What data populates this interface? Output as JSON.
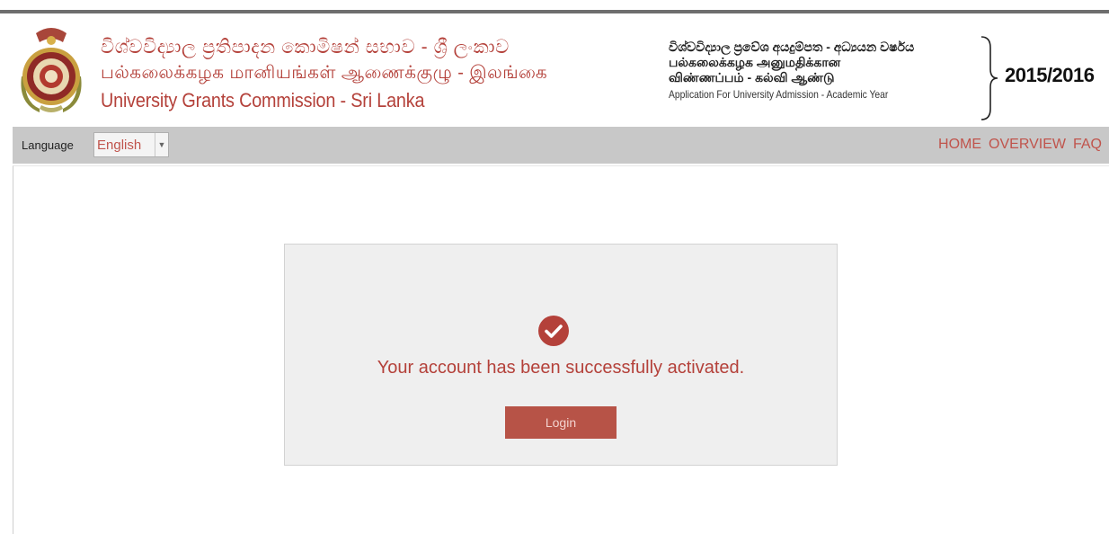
{
  "header": {
    "org_sinhala": "විශ්වවිද්‍යාල ප්‍රතිපාදන කොමිෂන් සභාව - ශ්‍රී ලංකාව",
    "org_tamil": "பல்கலைக்கழக மானியங்கள் ஆணைக்குழு - இலங்கை",
    "org_english": "University Grants Commission - Sri Lanka",
    "app_sinhala": "විශ්වවිද්‍යාල ප්‍රවේශ අයදුම්පත - අධ්‍යයන වර්ෂය",
    "app_tamil_1": "பல்கலைக்கழக அனுமதிக்கான",
    "app_tamil_2": "விண்ணப்பம் - கல்வி ஆண்டு",
    "app_english": "Application For University Admission - Academic Year",
    "year": "2015/2016"
  },
  "navbar": {
    "language_label": "Language",
    "language_value": "English",
    "links": [
      "HOME",
      "OVERVIEW",
      "FAQ"
    ]
  },
  "card": {
    "message": "Your account has been successfully activated.",
    "login_label": "Login"
  },
  "icons": {
    "crest": "university-crest-icon",
    "success": "check-circle-icon",
    "dropdown": "caret-down-icon"
  },
  "colors": {
    "brand": "#b4413a",
    "button": "#b75347",
    "navbar": "#c8c8c8"
  }
}
